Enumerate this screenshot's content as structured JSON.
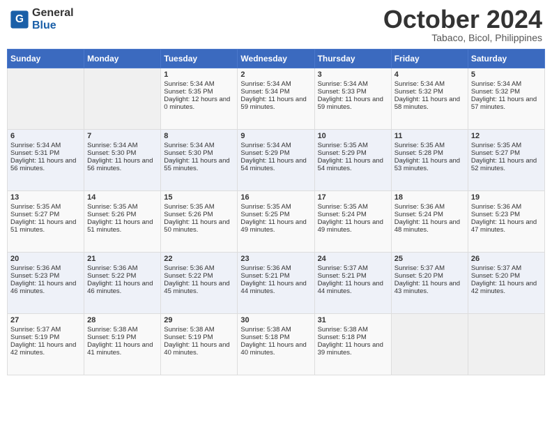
{
  "header": {
    "logo_line1": "General",
    "logo_line2": "Blue",
    "month": "October 2024",
    "location": "Tabaco, Bicol, Philippines"
  },
  "weekdays": [
    "Sunday",
    "Monday",
    "Tuesday",
    "Wednesday",
    "Thursday",
    "Friday",
    "Saturday"
  ],
  "weeks": [
    [
      {
        "day": "",
        "info": ""
      },
      {
        "day": "",
        "info": ""
      },
      {
        "day": "1",
        "info": "Sunrise: 5:34 AM\nSunset: 5:35 PM\nDaylight: 12 hours and 0 minutes."
      },
      {
        "day": "2",
        "info": "Sunrise: 5:34 AM\nSunset: 5:34 PM\nDaylight: 11 hours and 59 minutes."
      },
      {
        "day": "3",
        "info": "Sunrise: 5:34 AM\nSunset: 5:33 PM\nDaylight: 11 hours and 59 minutes."
      },
      {
        "day": "4",
        "info": "Sunrise: 5:34 AM\nSunset: 5:32 PM\nDaylight: 11 hours and 58 minutes."
      },
      {
        "day": "5",
        "info": "Sunrise: 5:34 AM\nSunset: 5:32 PM\nDaylight: 11 hours and 57 minutes."
      }
    ],
    [
      {
        "day": "6",
        "info": "Sunrise: 5:34 AM\nSunset: 5:31 PM\nDaylight: 11 hours and 56 minutes."
      },
      {
        "day": "7",
        "info": "Sunrise: 5:34 AM\nSunset: 5:30 PM\nDaylight: 11 hours and 56 minutes."
      },
      {
        "day": "8",
        "info": "Sunrise: 5:34 AM\nSunset: 5:30 PM\nDaylight: 11 hours and 55 minutes."
      },
      {
        "day": "9",
        "info": "Sunrise: 5:34 AM\nSunset: 5:29 PM\nDaylight: 11 hours and 54 minutes."
      },
      {
        "day": "10",
        "info": "Sunrise: 5:35 AM\nSunset: 5:29 PM\nDaylight: 11 hours and 54 minutes."
      },
      {
        "day": "11",
        "info": "Sunrise: 5:35 AM\nSunset: 5:28 PM\nDaylight: 11 hours and 53 minutes."
      },
      {
        "day": "12",
        "info": "Sunrise: 5:35 AM\nSunset: 5:27 PM\nDaylight: 11 hours and 52 minutes."
      }
    ],
    [
      {
        "day": "13",
        "info": "Sunrise: 5:35 AM\nSunset: 5:27 PM\nDaylight: 11 hours and 51 minutes."
      },
      {
        "day": "14",
        "info": "Sunrise: 5:35 AM\nSunset: 5:26 PM\nDaylight: 11 hours and 51 minutes."
      },
      {
        "day": "15",
        "info": "Sunrise: 5:35 AM\nSunset: 5:26 PM\nDaylight: 11 hours and 50 minutes."
      },
      {
        "day": "16",
        "info": "Sunrise: 5:35 AM\nSunset: 5:25 PM\nDaylight: 11 hours and 49 minutes."
      },
      {
        "day": "17",
        "info": "Sunrise: 5:35 AM\nSunset: 5:24 PM\nDaylight: 11 hours and 49 minutes."
      },
      {
        "day": "18",
        "info": "Sunrise: 5:36 AM\nSunset: 5:24 PM\nDaylight: 11 hours and 48 minutes."
      },
      {
        "day": "19",
        "info": "Sunrise: 5:36 AM\nSunset: 5:23 PM\nDaylight: 11 hours and 47 minutes."
      }
    ],
    [
      {
        "day": "20",
        "info": "Sunrise: 5:36 AM\nSunset: 5:23 PM\nDaylight: 11 hours and 46 minutes."
      },
      {
        "day": "21",
        "info": "Sunrise: 5:36 AM\nSunset: 5:22 PM\nDaylight: 11 hours and 46 minutes."
      },
      {
        "day": "22",
        "info": "Sunrise: 5:36 AM\nSunset: 5:22 PM\nDaylight: 11 hours and 45 minutes."
      },
      {
        "day": "23",
        "info": "Sunrise: 5:36 AM\nSunset: 5:21 PM\nDaylight: 11 hours and 44 minutes."
      },
      {
        "day": "24",
        "info": "Sunrise: 5:37 AM\nSunset: 5:21 PM\nDaylight: 11 hours and 44 minutes."
      },
      {
        "day": "25",
        "info": "Sunrise: 5:37 AM\nSunset: 5:20 PM\nDaylight: 11 hours and 43 minutes."
      },
      {
        "day": "26",
        "info": "Sunrise: 5:37 AM\nSunset: 5:20 PM\nDaylight: 11 hours and 42 minutes."
      }
    ],
    [
      {
        "day": "27",
        "info": "Sunrise: 5:37 AM\nSunset: 5:19 PM\nDaylight: 11 hours and 42 minutes."
      },
      {
        "day": "28",
        "info": "Sunrise: 5:38 AM\nSunset: 5:19 PM\nDaylight: 11 hours and 41 minutes."
      },
      {
        "day": "29",
        "info": "Sunrise: 5:38 AM\nSunset: 5:19 PM\nDaylight: 11 hours and 40 minutes."
      },
      {
        "day": "30",
        "info": "Sunrise: 5:38 AM\nSunset: 5:18 PM\nDaylight: 11 hours and 40 minutes."
      },
      {
        "day": "31",
        "info": "Sunrise: 5:38 AM\nSunset: 5:18 PM\nDaylight: 11 hours and 39 minutes."
      },
      {
        "day": "",
        "info": ""
      },
      {
        "day": "",
        "info": ""
      }
    ]
  ]
}
